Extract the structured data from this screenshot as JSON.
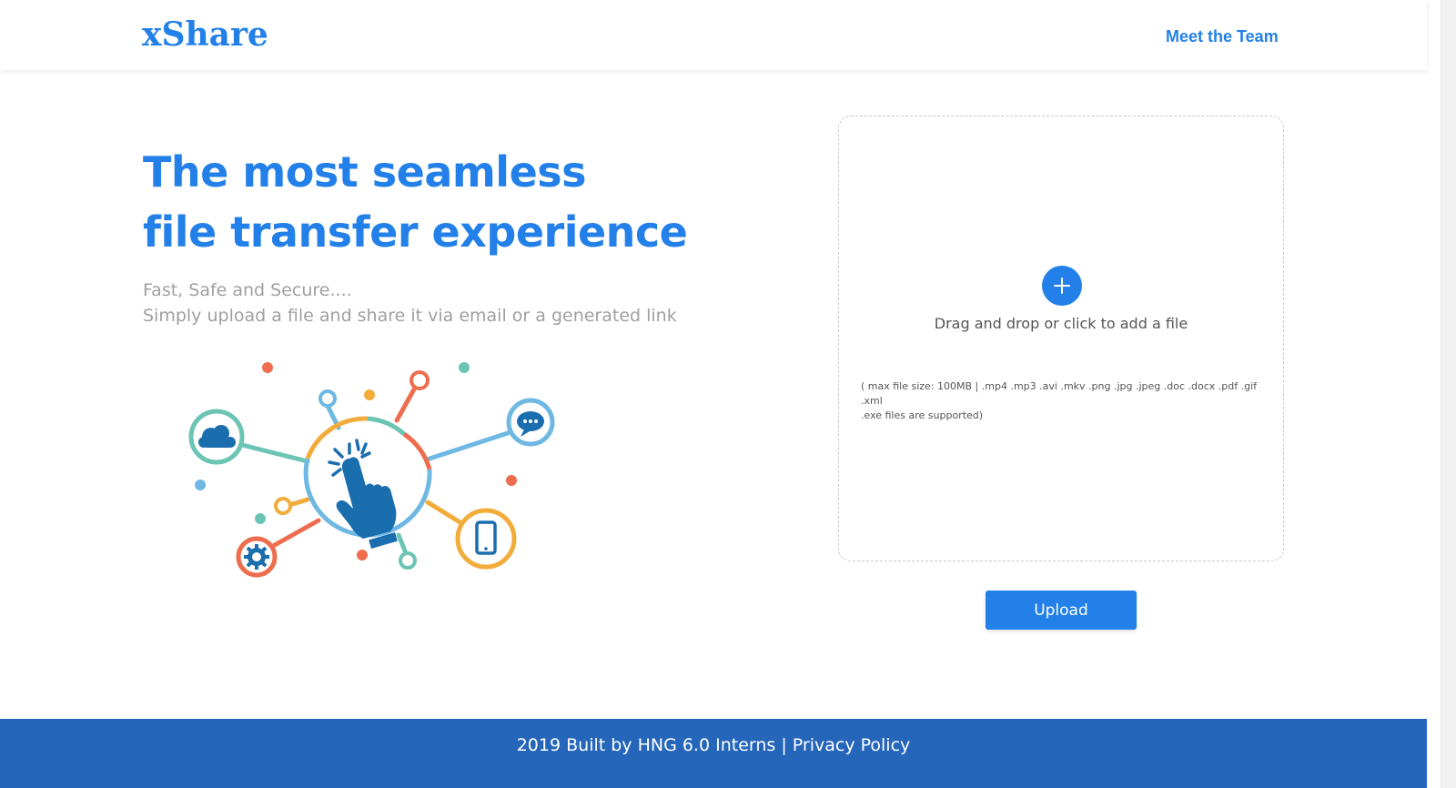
{
  "navbar": {
    "brand": "xShare",
    "meet_team": "Meet the Team",
    "brand_color": "#2280e8"
  },
  "hero": {
    "headline_line1": "The most seamless",
    "headline_line2": "file transfer experience",
    "subline_line1": "Fast, Safe and Secure....",
    "subline_line2": "Simply upload a file and share it via email or a generated link"
  },
  "illustration": {
    "hub_icon": "pointer-hand-icon",
    "node_icons": [
      "cloud-icon",
      "chat-bubble-icon",
      "gear-icon",
      "smartphone-icon"
    ],
    "colors": {
      "teal": "#6cc4b4",
      "orange": "#ee6d4e",
      "yellow": "#f2ac3c",
      "blue": "#6fb8e3",
      "dark_blue": "#1b6eae"
    }
  },
  "upload": {
    "dropzone_text": "Drag and drop or click to add a file",
    "note_line1": "( max file size: 100MB | .mp4 .mp3 .avi .mkv .png .jpg .jpeg .doc .docx .pdf .gif .xml",
    "note_line2": ".exe files are supported)",
    "button": "Upload"
  },
  "footer": {
    "credit": "2019 Built by HNG 6.0 Interns",
    "separator": " | ",
    "privacy": "Privacy Policy",
    "background": "#2566bb"
  }
}
